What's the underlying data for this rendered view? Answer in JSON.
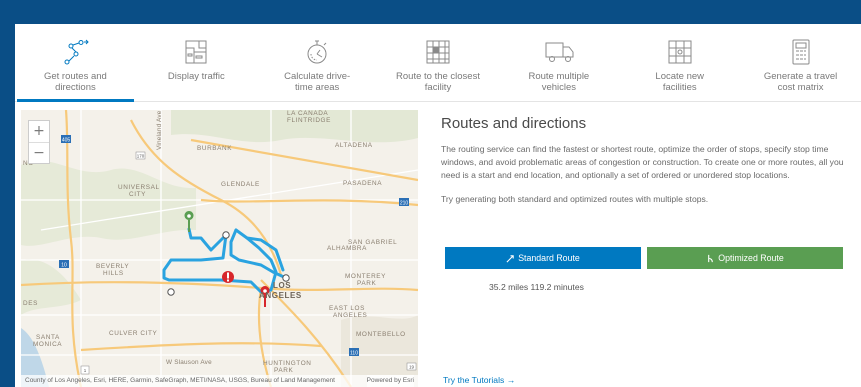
{
  "tabs": [
    {
      "label": "Get routes and\ndirections",
      "icon": "route-stops-icon",
      "active": true
    },
    {
      "label": "Display traffic",
      "icon": "traffic-map-icon",
      "active": false
    },
    {
      "label": "Calculate drive-\ntime areas",
      "icon": "stopwatch-icon",
      "active": false
    },
    {
      "label": "Route to the closest\nfacility",
      "icon": "facility-map-icon",
      "active": false
    },
    {
      "label": "Route multiple\nvehicles",
      "icon": "truck-icon",
      "active": false
    },
    {
      "label": "Locate new\nfacilities",
      "icon": "location-grid-icon",
      "active": false
    },
    {
      "label": "Generate a travel\ncost matrix",
      "icon": "calculator-icon",
      "active": false
    }
  ],
  "map": {
    "zoom_in": "+",
    "zoom_out": "−",
    "attribution": "County of Los Angeles, Esri, HERE, Garmin, SafeGraph, METI/NASA, USGS, Bureau of Land Management",
    "powered_by": "Powered by Esri",
    "labels": {
      "la_canada_1": "LA CANADA",
      "la_canada_2": "FLINTRIDGE",
      "burbank": "BURBANK",
      "altadena": "ALTADENA",
      "universal_1": "UNIVERSAL",
      "universal_2": "CITY",
      "glendale": "GLENDALE",
      "pasadena": "PASADENA",
      "no": "NO",
      "alhambra": "ALHAMBRA",
      "san_gabriel_1": "SAN GABRIEL",
      "beverly_1": "BEVERLY",
      "beverly_2": "HILLS",
      "los_1": "LOS",
      "los_2": "ANGELES",
      "monterey_1": "MONTEREY",
      "monterey_2": "PARK",
      "des": "DES",
      "east_la_1": "EAST LOS",
      "east_la_2": "ANGELES",
      "culver": "CULVER CITY",
      "santa_1": "SANTA",
      "santa_2": "MONICA",
      "montebello": "MONTEBELLO",
      "slauson": "W Slauson Ave",
      "huntington_1": "HUNTINGTON",
      "huntington_2": "PARK",
      "vineland": "Vineland Ave",
      "hwy_405": "405",
      "hwy_170": "170",
      "hwy_210": "210",
      "hwy_10": "10",
      "hwy_1": "1",
      "hwy_19": "19",
      "hwy_110": "110"
    }
  },
  "content": {
    "title": "Routes and directions",
    "description": "The routing service can find the fastest or shortest route, optimize the order of stops, specify stop time windows, and avoid problematic areas of congestion or construction. To create one or more routes, all you need is a start and end location, and optionally a set of ordered or unordered stop locations.",
    "try_text": "Try generating both standard and optimized routes with multiple stops.",
    "standard_button": "Standard Route",
    "optimized_button": "Optimized Route",
    "stats": "35.2 miles 119.2 minutes",
    "tutorials_link": "Try the Tutorials →"
  },
  "colors": {
    "frame": "#0a4e86",
    "accent": "#0079c1",
    "optimized": "#5a9e52",
    "route": "#2aa3e0",
    "barrier": "#d7262b"
  }
}
